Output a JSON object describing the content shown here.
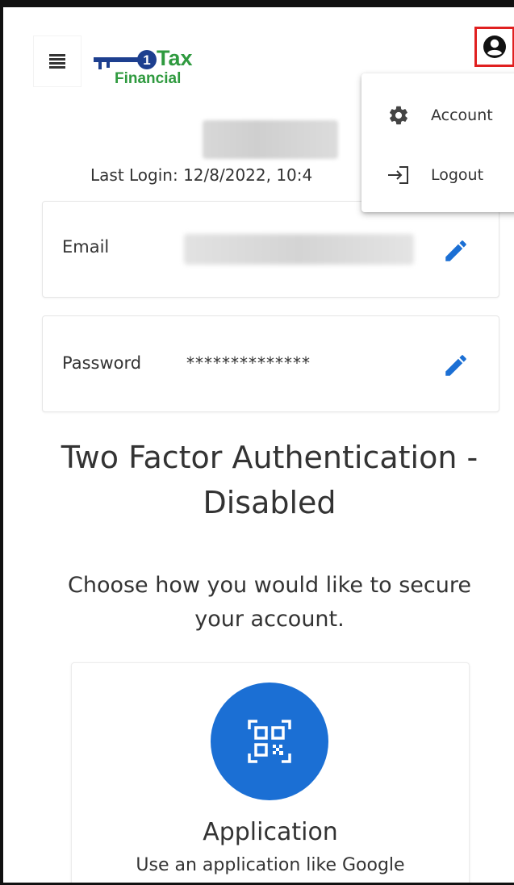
{
  "header": {
    "logo_text_top": "Tax",
    "logo_text_bottom": "Financial",
    "logo_number": "1",
    "brand_color": "#2f9a3f",
    "menu_icon": "hamburger-icon",
    "user_icon": "account-circle-icon"
  },
  "user_menu": {
    "items": [
      {
        "label": "Account",
        "icon": "gear-icon"
      },
      {
        "label": "Logout",
        "icon": "logout-icon"
      }
    ]
  },
  "account": {
    "last_login": "Last Login: 12/8/2022, 10:4",
    "email_label": "Email",
    "password_label": "Password",
    "password_value": "**************",
    "edit_icon": "pencil-icon",
    "accent_color": "#1b6fd4"
  },
  "two_factor": {
    "title": "Two Factor Authentication - Disabled",
    "subtitle": "Choose how you would like to secure your account.",
    "options": [
      {
        "title": "Application",
        "description": "Use an application like Google",
        "icon": "qr-code-icon"
      }
    ]
  }
}
